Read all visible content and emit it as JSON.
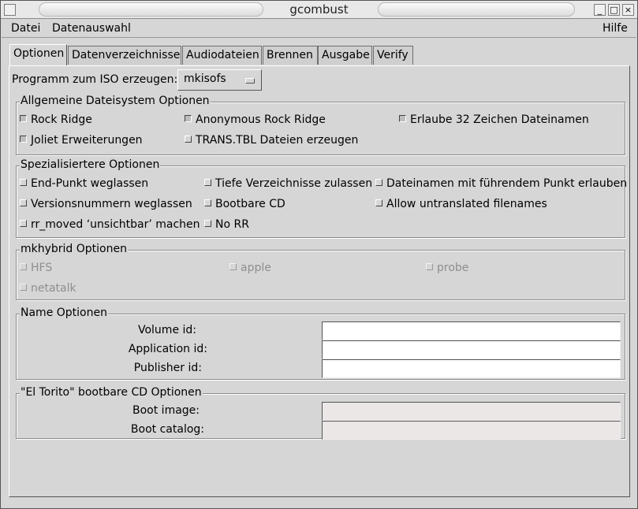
{
  "window": {
    "title": "gcombust"
  },
  "menubar": {
    "datei": "Datei",
    "datenauswahl": "Datenauswahl",
    "hilfe": "Hilfe"
  },
  "tabs": [
    {
      "label": "Optionen",
      "active": true
    },
    {
      "label": "Datenverzeichnisse"
    },
    {
      "label": "Audiodateien"
    },
    {
      "label": "Brennen"
    },
    {
      "label": "Ausgabe"
    },
    {
      "label": "Verify"
    }
  ],
  "program": {
    "label": "Programm zum ISO erzeugen:",
    "selected": "mkisofs"
  },
  "fs_group": {
    "title": "Allgemeine Dateisystem Optionen",
    "options": [
      {
        "label": "Rock Ridge",
        "checked": true
      },
      {
        "label": "Anonymous Rock Ridge",
        "checked": true
      },
      {
        "label": "Erlaube 32 Zeichen Dateinamen",
        "checked": true
      },
      {
        "label": "Joliet Erweiterungen",
        "checked": true
      },
      {
        "label": "TRANS.TBL Dateien erzeugen",
        "checked": false
      }
    ]
  },
  "special_group": {
    "title": "Spezialisiertere Optionen",
    "options": [
      {
        "label": "End-Punkt weglassen"
      },
      {
        "label": "Tiefe Verzeichnisse zulassen"
      },
      {
        "label": "Dateinamen mit führendem Punkt erlauben"
      },
      {
        "label": "Versionsnummern weglassen"
      },
      {
        "label": "Bootbare CD"
      },
      {
        "label": "Allow untranslated filenames"
      },
      {
        "label": "rr_moved ‘unsichtbar’ machen"
      },
      {
        "label": "No RR"
      }
    ]
  },
  "hybrid_group": {
    "title": "mkhybrid Optionen",
    "options": [
      {
        "label": "HFS"
      },
      {
        "label": "apple"
      },
      {
        "label": "probe"
      },
      {
        "label": "netatalk"
      }
    ]
  },
  "name_group": {
    "title": "Name Optionen",
    "fields": [
      {
        "label": "Volume id:",
        "value": ""
      },
      {
        "label": "Application id:",
        "value": ""
      },
      {
        "label": "Publisher id:",
        "value": ""
      }
    ]
  },
  "torito_group": {
    "title": "\"El Torito\" bootbare CD Optionen",
    "fields": [
      {
        "label": "Boot image:",
        "value": ""
      },
      {
        "label": "Boot catalog:",
        "value": ""
      }
    ]
  }
}
